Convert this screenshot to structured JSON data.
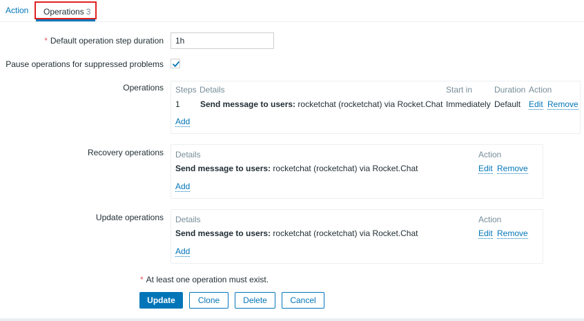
{
  "tabs": {
    "action_label": "Action",
    "operations_label": "Operations",
    "operations_count": "3"
  },
  "form": {
    "step_duration_label": "Default operation step duration",
    "step_duration_value": "1h",
    "pause_label": "Pause operations for suppressed problems",
    "pause_checked": true,
    "operations_label": "Operations",
    "recovery_label": "Recovery operations",
    "update_label": "Update operations",
    "required_marker": "*"
  },
  "operations": {
    "headers": {
      "steps": "Steps",
      "details": "Details",
      "start_in": "Start in",
      "duration": "Duration",
      "action": "Action"
    },
    "rows": [
      {
        "step": "1",
        "details_bold": "Send message to users:",
        "details_rest": " rocketchat (rocketchat) via Rocket.Chat",
        "start_in": "Immediately",
        "duration": "Default",
        "edit": "Edit",
        "remove": "Remove"
      }
    ],
    "add_label": "Add"
  },
  "recovery": {
    "headers": {
      "details": "Details",
      "action": "Action"
    },
    "rows": [
      {
        "details_bold": "Send message to users:",
        "details_rest": " rocketchat (rocketchat) via Rocket.Chat",
        "edit": "Edit",
        "remove": "Remove"
      }
    ],
    "add_label": "Add"
  },
  "update_ops": {
    "headers": {
      "details": "Details",
      "action": "Action"
    },
    "rows": [
      {
        "details_bold": "Send message to users:",
        "details_rest": " rocketchat (rocketchat) via Rocket.Chat",
        "edit": "Edit",
        "remove": "Remove"
      }
    ],
    "add_label": "Add"
  },
  "note": "At least one operation must exist.",
  "buttons": {
    "update": "Update",
    "clone": "Clone",
    "delete": "Delete",
    "cancel": "Cancel"
  },
  "colors": {
    "accent": "#0275b8",
    "required": "#e45959",
    "tab_highlight": "#e02020"
  }
}
